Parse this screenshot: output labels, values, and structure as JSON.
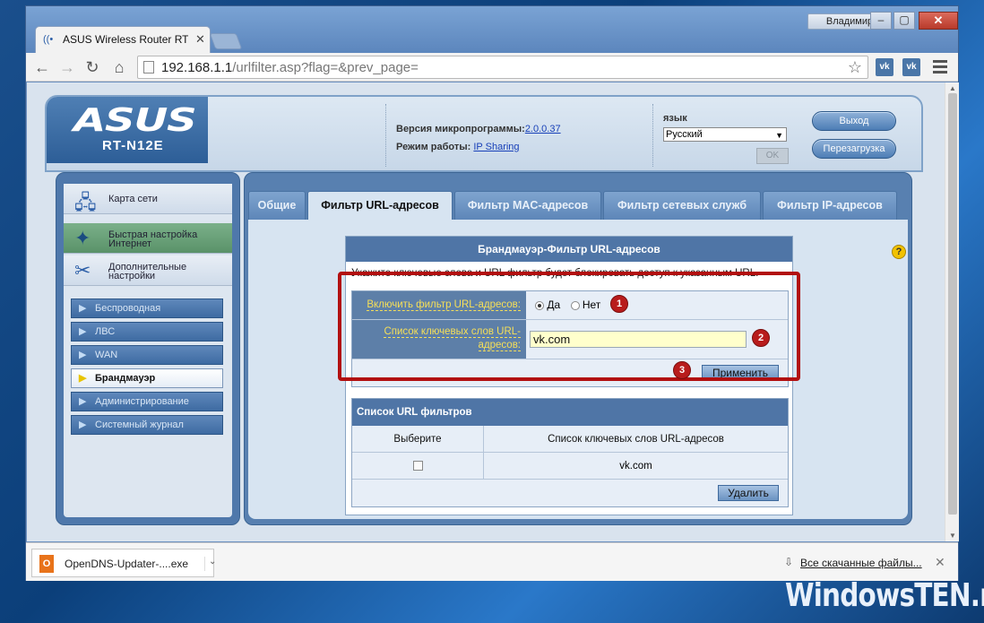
{
  "browser": {
    "tab_title": "ASUS Wireless Router RT-N",
    "user_name": "Владимир",
    "url_host": "192.168.1.1",
    "url_path": "/urlfilter.asp?flag=&prev_page=",
    "ext1_label": "vk",
    "ext2_label": "vk"
  },
  "header": {
    "logo": "ASUS",
    "model": "RT-N12E",
    "firmware_label": "Версия микропрограммы:",
    "firmware_value": "2.0.0.37",
    "mode_label": "Режим работы:",
    "mode_value": "IP Sharing",
    "lang_label": "язык",
    "lang_value": "Русский",
    "ok_label": "OK",
    "logout_label": "Выход",
    "reboot_label": "Перезагрузка"
  },
  "sidebar": {
    "big_items": [
      {
        "label": "Карта сети"
      },
      {
        "label_line1": "Быстрая настройка",
        "label_line2": "Интернет"
      },
      {
        "label_line1": "Дополнительные",
        "label_line2": "настройки"
      }
    ],
    "sub_items": [
      {
        "label": "Беспроводная"
      },
      {
        "label": "ЛВС"
      },
      {
        "label": "WAN"
      },
      {
        "label": "Брандмауэр",
        "active": true
      },
      {
        "label": "Администрирование"
      },
      {
        "label": "Системный журнал"
      }
    ]
  },
  "tabs": [
    {
      "label": "Общие"
    },
    {
      "label": "Фильтр URL-адресов",
      "active": true
    },
    {
      "label": "Фильтр MAC-адресов"
    },
    {
      "label": "Фильтр сетевых служб"
    },
    {
      "label": "Фильтр IP-адресов"
    }
  ],
  "content": {
    "title": "Брандмауэр-Фильтр URL-адресов",
    "description": "Укажите ключевые слова и URL фильтр будет блокировать доступ к указанным URL.",
    "enable_label": "Включить фильтр URL-адресов:",
    "radio_yes": "Да",
    "radio_no": "Нет",
    "radio_selected": "Да",
    "keywords_label_line1": "Список ключевых слов URL-",
    "keywords_label_line2": "адресов:",
    "keyword_input_value": "vk.com",
    "apply_label": "Применить",
    "list_title": "Список URL фильтров",
    "col_select": "Выберите",
    "col_keywords": "Список ключевых слов URL-адресов",
    "rows": [
      {
        "keyword": "vk.com"
      }
    ],
    "delete_label": "Удалить",
    "markers": [
      "1",
      "2",
      "3"
    ]
  },
  "downloads": {
    "file_name": "OpenDNS-Updater-....exe",
    "all_files_label": "Все скачанные файлы..."
  },
  "watermark": "WindowsTEN.ru"
}
